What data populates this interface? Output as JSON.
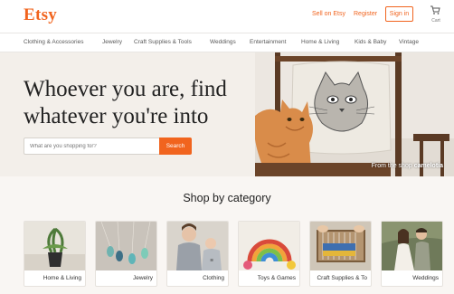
{
  "header": {
    "logo": "Etsy",
    "sell_label": "Sell on Etsy",
    "register_label": "Register",
    "signin_label": "Sign in",
    "cart_label": "Cart",
    "cart_icon": "cart-icon",
    "brand_color": "#f1641e"
  },
  "nav": {
    "items": [
      "Clothing & Accessories",
      "Jewelry",
      "Craft Supplies & Tools",
      "Weddings",
      "Entertainment",
      "Home & Living",
      "Kids & Baby",
      "Vintage"
    ]
  },
  "hero": {
    "headline_line1": "Whoever you are, find",
    "headline_line2": "whatever you're into",
    "search_placeholder": "What are you shopping for?",
    "search_button": "Search",
    "credit_prefix": "From the shop",
    "credit_shop": "camelotia"
  },
  "categories": {
    "title": "Shop by category",
    "items": [
      {
        "label": "Home & Living"
      },
      {
        "label": "Jewelry"
      },
      {
        "label": "Clothing"
      },
      {
        "label": "Toys & Games"
      },
      {
        "label": "Craft Supplies & To"
      },
      {
        "label": "Weddings"
      }
    ]
  }
}
